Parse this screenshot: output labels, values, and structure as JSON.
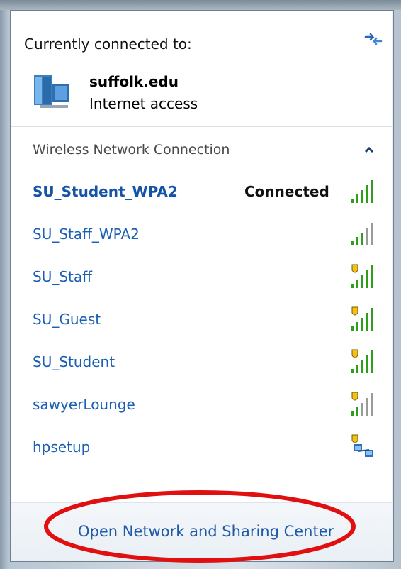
{
  "popup": {
    "header": "Currently connected to:",
    "current_network": {
      "name": "suffolk.edu",
      "status": "Internet access"
    },
    "section_title": "Wireless Network Connection",
    "networks": [
      {
        "ssid": "SU_Student_WPA2",
        "status": "Connected",
        "secured": false,
        "signal": "full",
        "active": true
      },
      {
        "ssid": "SU_Staff_WPA2",
        "status": "",
        "secured": false,
        "signal": "partial",
        "active": false
      },
      {
        "ssid": "SU_Staff",
        "status": "",
        "secured": true,
        "signal": "full",
        "active": false
      },
      {
        "ssid": "SU_Guest",
        "status": "",
        "secured": true,
        "signal": "full",
        "active": false
      },
      {
        "ssid": "SU_Student",
        "status": "",
        "secured": true,
        "signal": "full",
        "active": false
      },
      {
        "ssid": "sawyerLounge",
        "status": "",
        "secured": true,
        "signal": "weak",
        "active": false
      },
      {
        "ssid": "hpsetup",
        "status": "",
        "secured": true,
        "signal": "adhoc",
        "active": false
      }
    ],
    "footer_link": "Open Network and Sharing Center"
  },
  "colors": {
    "link": "#1a5fb4",
    "signal_green": "#2f9e1a",
    "annotation_red": "#e01010"
  },
  "icons": [
    "refresh-icon",
    "network-computer-icon",
    "chevron-up-icon",
    "signal-bars-icon",
    "security-shield-icon",
    "adhoc-network-icon"
  ]
}
